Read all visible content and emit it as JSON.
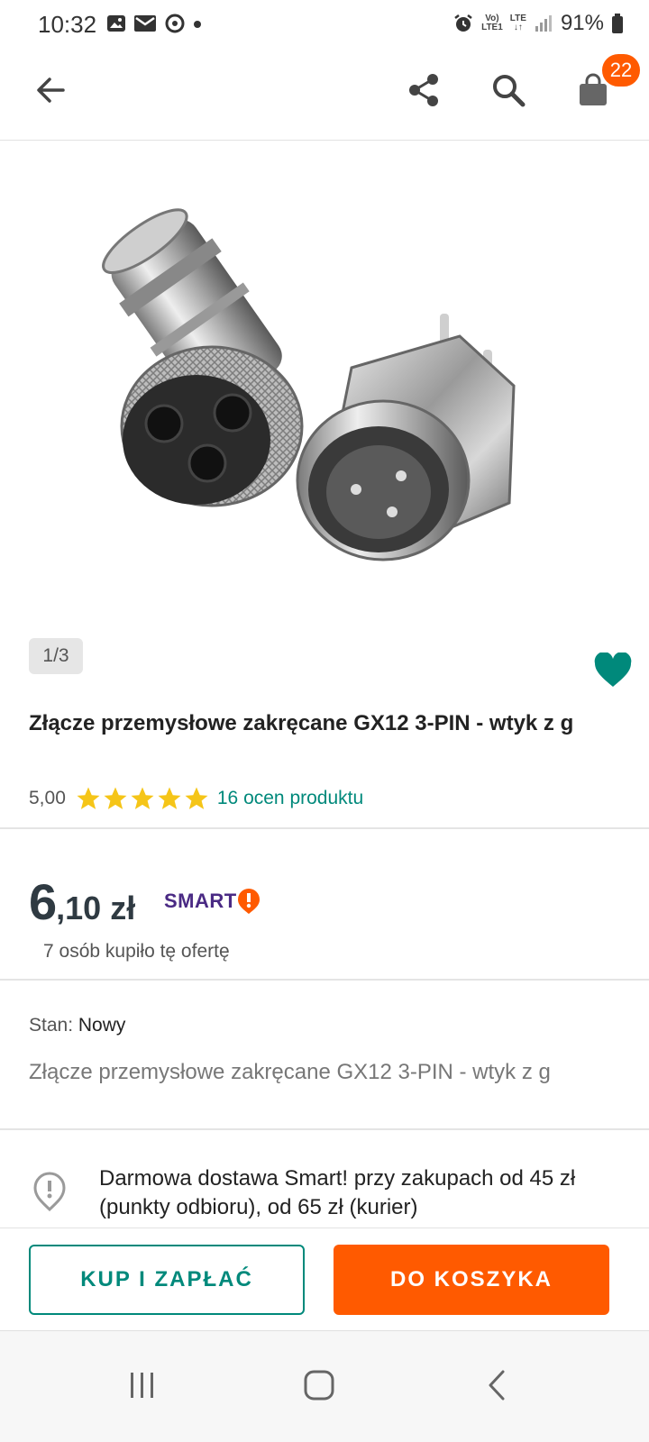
{
  "status": {
    "time": "10:32",
    "lte_top": "Vo)",
    "lte_bottom": "LTE1",
    "lte2_top": "LTE",
    "battery": "91%"
  },
  "app_bar": {
    "back_icon": "arrow-left-icon",
    "share_icon": "share-icon",
    "search_icon": "search-icon",
    "cart_icon": "cart-icon",
    "cart_count": "22"
  },
  "gallery": {
    "counter": "1/3",
    "favorite_color": "#00897b"
  },
  "product": {
    "title": "Złącze przemysłowe zakręcane GX12 3-PIN - wtyk z g",
    "rating_value": "5,00",
    "stars": 5,
    "rating_link": "16 ocen produktu",
    "price_int": "6",
    "price_frac": ",10",
    "currency": "zł",
    "smart_label": "SMART",
    "buyers": "7 osób kupiło tę ofertę",
    "condition_label": "Stan:",
    "condition_value": "Nowy",
    "description": "Złącze przemysłowe zakręcane GX12 3-PIN - wtyk z g"
  },
  "delivery": {
    "text": "Darmowa dostawa Smart! przy zakupach od 45 zł (punkty odbioru), od 65 zł (kurier)"
  },
  "actions": {
    "buy_now": "KUP I ZAPŁAĆ",
    "add_to_cart": "DO KOSZYKA"
  },
  "colors": {
    "accent": "#00897b",
    "primary": "#ff5a00",
    "star": "#f5c518"
  }
}
